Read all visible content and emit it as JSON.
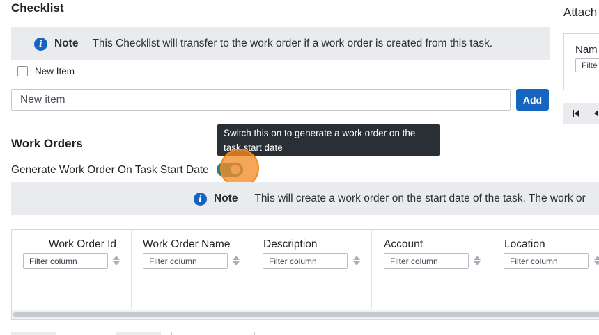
{
  "checklist": {
    "title": "Checklist",
    "note_label": "Note",
    "note_text": "This Checklist will transfer to the work order if a work order is created from this task.",
    "items": [
      {
        "label": "New Item",
        "checked": false
      }
    ],
    "new_item_placeholder": "New item",
    "add_label": "Add"
  },
  "attachments": {
    "title": "Attach",
    "column_header": "Nam",
    "filter_placeholder": "Filte"
  },
  "work_orders": {
    "title": "Work Orders",
    "toggle_label": "Generate Work Order On Task Start Date",
    "toggle_on": true,
    "tooltip": "Switch this on to generate a work order on the task start date",
    "note_label": "Note",
    "note_text": "This will create a work order on the start date of the task. The work or",
    "columns": [
      {
        "title": "Work Order Id",
        "filter_placeholder": "Filter column"
      },
      {
        "title": "Work Order Name",
        "filter_placeholder": "Filter column"
      },
      {
        "title": "Description",
        "filter_placeholder": "Filter column"
      },
      {
        "title": "Account",
        "filter_placeholder": "Filter column"
      },
      {
        "title": "Location",
        "filter_placeholder": "Filter column"
      }
    ]
  },
  "colors": {
    "primary": "#1565c0",
    "note_background": "#e9ebee",
    "tooltip_background": "#2a2f36",
    "toggle_on": "#2a7f7f",
    "cursor_highlight": "#f58c28"
  },
  "icons": {
    "note": "info-icon",
    "pager_first": "first-page-icon",
    "pager_prev": "prev-page-icon",
    "sort": "sort-icon"
  }
}
